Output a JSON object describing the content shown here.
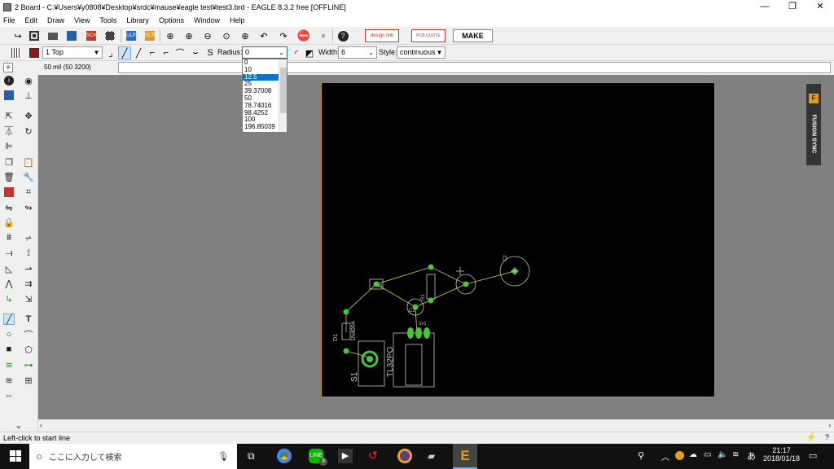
{
  "window": {
    "title": "2 Board - C:¥Users¥y0808¥Desktop¥srdc¥mause¥eagle test¥test3.brd - EAGLE 8.3.2 free [OFFLINE]",
    "minimize": "—",
    "restore": "❐",
    "close": "✕"
  },
  "menu": [
    "File",
    "Edit",
    "Draw",
    "View",
    "Tools",
    "Library",
    "Options",
    "Window",
    "Help"
  ],
  "toolbar": {
    "design_link": "design link",
    "pcb_quote": "PCB QUOTE",
    "make": "MAKE"
  },
  "params": {
    "layer_value": "1 Top",
    "layer_color": "#8b1a1a",
    "radius_label": "Radius:",
    "radius_value": "0",
    "radius_options": [
      "0",
      "10",
      "12.5",
      "25",
      "39.37008",
      "50",
      "78.74016",
      "98.4252",
      "100",
      "196.85039"
    ],
    "radius_selected_index": 2,
    "width_label": "Width:",
    "width_value": "6",
    "style_label": "Style:",
    "style_value": "continuous"
  },
  "command": {
    "grid_readout": "50 mil (50 3200)"
  },
  "board": {
    "labels": {
      "d1": "D1",
      "d1_part": "1N4004",
      "s1": "S1",
      "tl32": "TL32PO",
      "r1": "R1",
      "c2": "C2",
      "c1": "C1",
      "d": "D",
      "sv": "SV1"
    }
  },
  "fusion": {
    "label": "FUSION SYNC"
  },
  "status": {
    "text": "Left-click to start line"
  },
  "taskbar": {
    "search_placeholder": "ここに入力して検索",
    "time": "21:17",
    "date": "2018/01/18",
    "ime": "あ",
    "line_badge": "3"
  },
  "colors": {
    "canvas_bg": "#808080",
    "board_bg": "#000000",
    "board_outline": "#c8870a",
    "pad_green": "#46c832",
    "silk": "#c8c8c8",
    "airwire": "#d4d44a",
    "selection": "#0078d7"
  }
}
